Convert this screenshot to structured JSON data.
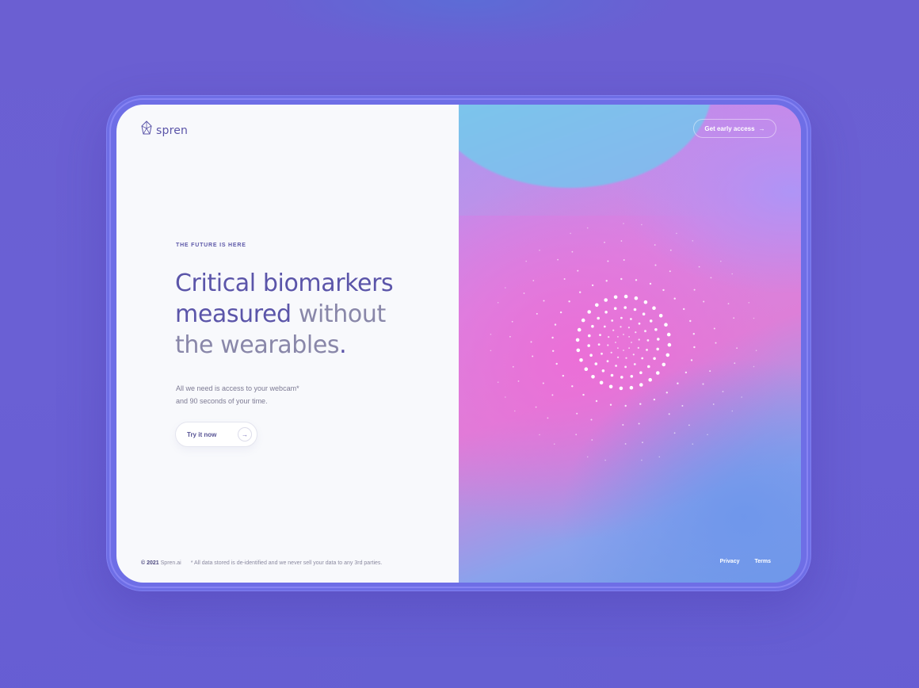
{
  "brand": {
    "name": "spren",
    "logo_icon": "gem-icon"
  },
  "hero": {
    "eyebrow": "THE FUTURE IS HERE",
    "headline_part1": "Critical biomarkers",
    "headline_part2": "measured",
    "headline_part3": " without",
    "headline_part4": "the wearables",
    "headline_period": ".",
    "sub_line1": "All we need is access to your webcam*",
    "sub_line2": "and 90 seconds of your time."
  },
  "try_button": {
    "label": "Try it now",
    "icon": "arrow-right-icon"
  },
  "header_right": {
    "cta_label": "Get early access",
    "cta_icon": "arrow-right-icon"
  },
  "footer": {
    "copyright_year": "© 2021",
    "copyright_name": "Spren.ai",
    "disclaimer": "* All data stored is de-identified and we never sell your data to any 3rd parties.",
    "links": [
      "Privacy",
      "Terms"
    ]
  },
  "colors": {
    "page_bg": "#6b5fd2",
    "frame": "#6e6ee6",
    "left_panel": "#f8f9fc",
    "headline": "#5b55a9",
    "headline_muted": "#8987a9",
    "accent_pink": "#dd7fd8",
    "accent_blue": "#76d1ee"
  }
}
